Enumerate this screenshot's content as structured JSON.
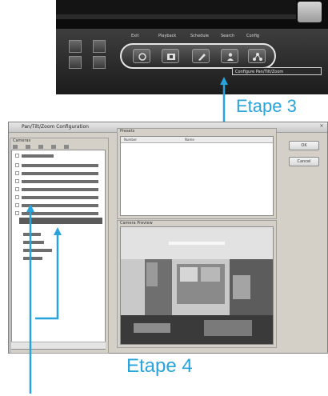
{
  "player": {
    "labels": [
      "Exit",
      "Playback",
      "Schedule",
      "Search",
      "Config"
    ],
    "tooltip": "Configure Pan/Tilt/Zoom"
  },
  "steps": {
    "step3": "Etape 3",
    "step4": "Etape 4"
  },
  "dialog": {
    "title": "Pan/Tilt/Zoom Configuration",
    "tree_group": "Cameras",
    "ptz_group": "Presets",
    "columns": [
      "Number",
      "Name"
    ],
    "preview_group": "Camera Preview",
    "ok": "OK",
    "cancel": "Cancel"
  },
  "colors": {
    "annotation": "#29a3dc"
  }
}
